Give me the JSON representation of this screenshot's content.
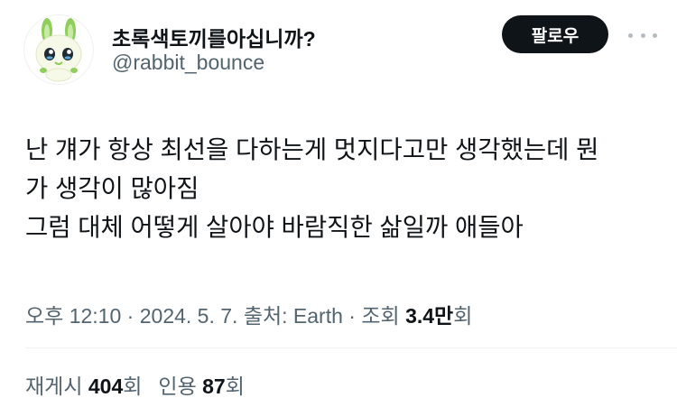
{
  "author": {
    "display_name": "초록색토끼를아십니까?",
    "handle": "@rabbit_bounce",
    "avatar_icon": "green-rabbit-character-icon"
  },
  "follow_button": {
    "label": "팔로우"
  },
  "more_button": {
    "icon": "more-dots-icon"
  },
  "tweet": {
    "lines": [
      "난 걔가 항상 최선을 다하는게 멋지다고만 생각했는데 뭔",
      "가 생각이 많아짐",
      "그럼 대체 어떻게 살아야 바람직한 삶일까 애들아"
    ]
  },
  "meta": {
    "time": "오후 12:10",
    "separator": " · ",
    "date": "2024. 5. 7.",
    "source_label": "출처: Earth",
    "views_label": "조회",
    "views_count": "3.4만",
    "views_suffix": "회"
  },
  "stats": {
    "retweets_label": "재게시",
    "retweets_count": "404",
    "retweets_suffix": "회",
    "quotes_label": "인용",
    "quotes_count": "87",
    "quotes_suffix": "회"
  },
  "colors": {
    "text_primary": "#0f1419",
    "text_secondary": "#536471",
    "follow_bg": "#0f1419",
    "divider": "#eff3f4",
    "avatar_green": "#8fce5a"
  }
}
